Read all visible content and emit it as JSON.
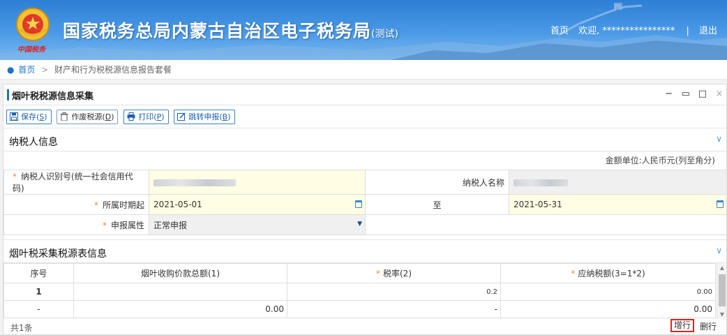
{
  "header": {
    "site_title": "国家税务总局内蒙古自治区电子税务局",
    "test_suffix": "(测试)",
    "emblem_text": "中国税务",
    "home_link": "首页",
    "welcome": "欢迎,",
    "user_masked": "****************",
    "divider": "|",
    "logout": "退出"
  },
  "breadcrumb": {
    "home": "首页",
    "separator": ">",
    "current": "财产和行为税税源信息报告套餐"
  },
  "panel": {
    "title": "烟叶税税源信息采集",
    "controls": {
      "minimize": "−",
      "restore": "▭",
      "maximize": "□",
      "close": "×"
    }
  },
  "toolbar": {
    "save": {
      "text": "保存(",
      "key": "S",
      "end": ")"
    },
    "void": {
      "text": "作废税源(",
      "key": "D",
      "end": ")"
    },
    "print": {
      "text": "打印(",
      "key": "P",
      "end": ")"
    },
    "jump": {
      "text": "跳转申报(",
      "key": "B",
      "end": ")"
    }
  },
  "taxpayer_section": {
    "title": "纳税人信息",
    "unit_note": "金额单位:人民币元(列至角分)",
    "id_label": "纳税人识别号(统一社会信用代码)",
    "name_label": "纳税人名称",
    "period_start_label": "所属时期起",
    "period_start_value": "2021-05-01",
    "period_to": "至",
    "period_end_value": "2021-05-31",
    "declare_attr_label": "申报属性",
    "declare_attr_value": "正常申报",
    "required_mark": "*"
  },
  "collection_section": {
    "title": "烟叶税采集税源表信息",
    "columns": {
      "seq": "序号",
      "total": "烟叶收购价款总额(1)",
      "rate": "税率(2)",
      "tax": "应纳税额(3=1*2)"
    },
    "rows": [
      {
        "seq": "1",
        "total": "",
        "rate": "0.2",
        "tax": "0.00"
      },
      {
        "seq": "-",
        "total": "0.00",
        "rate": "-",
        "tax": "0.00"
      }
    ],
    "count": "共1条",
    "add_row": "增行",
    "delete_row": "删行"
  },
  "colors": {
    "header_blue": "#2d7fd6",
    "link_blue": "#1a73c9",
    "required_orange": "#f0883a",
    "input_yellow": "#fffde4",
    "highlight_red": "#e0231c"
  }
}
